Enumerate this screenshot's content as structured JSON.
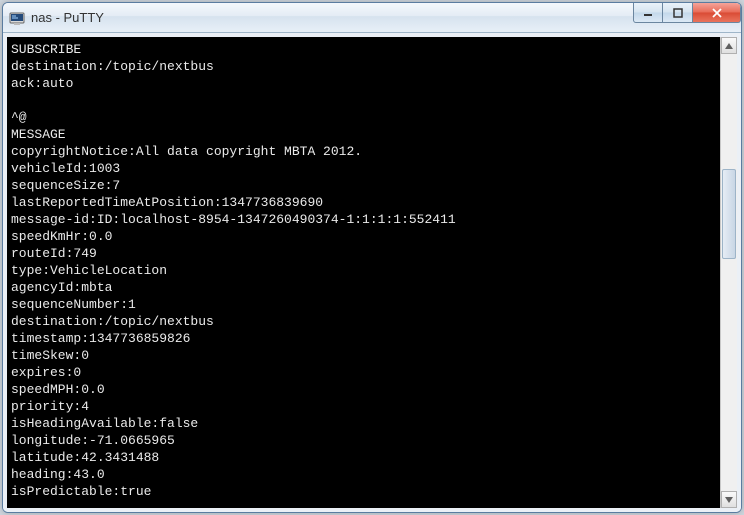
{
  "window": {
    "title": "nas - PuTTY",
    "icon_name": "putty-icon"
  },
  "terminal": {
    "lines": [
      "SUBSCRIBE",
      "destination:/topic/nextbus",
      "ack:auto",
      "",
      "^@",
      "MESSAGE",
      "copyrightNotice:All data copyright MBTA 2012.",
      "vehicleId:1003",
      "sequenceSize:7",
      "lastReportedTimeAtPosition:1347736839690",
      "message-id:ID:localhost-8954-1347260490374-1:1:1:1:552411",
      "speedKmHr:0.0",
      "routeId:749",
      "type:VehicleLocation",
      "agencyId:mbta",
      "sequenceNumber:1",
      "destination:/topic/nextbus",
      "timestamp:1347736859826",
      "timeSkew:0",
      "expires:0",
      "speedMPH:0.0",
      "priority:4",
      "isHeadingAvailable:false",
      "longitude:-71.0665965",
      "latitude:42.3431488",
      "heading:43.0",
      "isPredictable:true"
    ]
  },
  "controls": {
    "minimize": "minimize",
    "maximize": "maximize",
    "close": "close"
  }
}
